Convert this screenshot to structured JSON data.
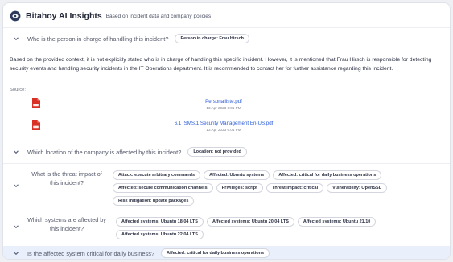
{
  "header": {
    "title": "Bitahoy AI Insights",
    "subtitle": "Based on incident data and company policies"
  },
  "q1": {
    "question": "Who is the person in charge of handling this incident?",
    "answer_pill": "Person in charge: Frau Hirsch",
    "answer": "Based on the provided context, it is not explicitly stated who is in charge of handling this specific incident. However, it is mentioned that Frau Hirsch is responsible for detecting security events and handling security incidents in the IT Operations department. It is recommended to contact her for further assistance regarding this incident.",
    "source_label": "Source:",
    "sources": [
      {
        "name": "Personalliste.pdf",
        "date": "13 Apr 2023 6:01 PM"
      },
      {
        "name": "6.1 ISMS.1 Security Management En-US.pdf",
        "date": "13 Apr 2023 6:01 PM"
      }
    ]
  },
  "q2": {
    "question": "Which location of the company is affected by this incident?",
    "pill": "Location: not provided"
  },
  "q3": {
    "question": "What is the threat impact of this incident?",
    "pills": [
      "Attack: execute arbitrary commands",
      "Affected: Ubuntu systems",
      "Affected: critical for daily business operations",
      "Affected: secure communication channels",
      "Privileges: script",
      "Threat impact: critical",
      "Vulnerability: OpenSSL",
      "Risk mitigation: update packages"
    ]
  },
  "q4": {
    "question": "Which systems are affected by this incident?",
    "pills": [
      "Affected systems: Ubuntu 18.04 LTS",
      "Affected systems: Ubuntu 20.04 LTS",
      "Affected systems: Ubuntu 21.10",
      "Affected systems: Ubuntu 22.04 LTS"
    ]
  },
  "q5": {
    "question": "Is the affected system critical for daily business?",
    "pill": "Affected: critical for daily business operations"
  },
  "colors": {
    "accent": "#2a5bd7",
    "pdf_red": "#d93025",
    "highlight": "#e9f0fb"
  },
  "icons": {
    "logo": "bitahoy-logo-icon",
    "chevron": "chevron-down-icon",
    "pdf": "pdf-file-icon"
  }
}
